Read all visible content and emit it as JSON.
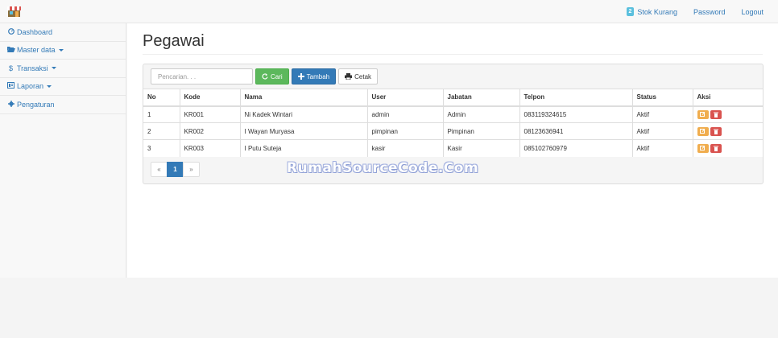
{
  "navbar": {
    "badge_count": "2",
    "stok_label": "Stok Kurang",
    "password_label": "Password",
    "logout_label": "Logout"
  },
  "sidebar": {
    "items": [
      {
        "label": "Dashboard",
        "icon": "dashboard-icon"
      },
      {
        "label": "Master data",
        "icon": "folder-open-icon"
      },
      {
        "label": "Transaksi",
        "icon": "dollar-icon"
      },
      {
        "label": "Laporan",
        "icon": "report-icon"
      },
      {
        "label": "Pengaturan",
        "icon": "gear-icon"
      }
    ]
  },
  "main": {
    "title": "Pegawai",
    "search_placeholder": "Pencarian. . .",
    "cari_label": "Cari",
    "tambah_label": "Tambah",
    "cetak_label": "Cetak",
    "columns": [
      "No",
      "Kode",
      "Nama",
      "User",
      "Jabatan",
      "Telpon",
      "Status",
      "Aksi"
    ],
    "rows": [
      {
        "no": "1",
        "kode": "KR001",
        "nama": "Ni Kadek Wintari",
        "user": "admin",
        "jabatan": "Admin",
        "telpon": "083119324615",
        "status": "Aktif"
      },
      {
        "no": "2",
        "kode": "KR002",
        "nama": "I Wayan Muryasa",
        "user": "pimpinan",
        "jabatan": "Pimpinan",
        "telpon": "08123636941",
        "status": "Aktif"
      },
      {
        "no": "3",
        "kode": "KR003",
        "nama": "I Putu Suteja",
        "user": "kasir",
        "jabatan": "Kasir",
        "telpon": "085102760979",
        "status": "Aktif"
      }
    ],
    "pagination": {
      "prev": "«",
      "current": "1",
      "next": "»"
    }
  },
  "watermark": "RumahSourceCode.Com",
  "colors": {
    "primary": "#337ab7",
    "success": "#5cb85c",
    "warning": "#f0ad4e",
    "danger": "#d9534f",
    "info": "#5bc0de"
  }
}
